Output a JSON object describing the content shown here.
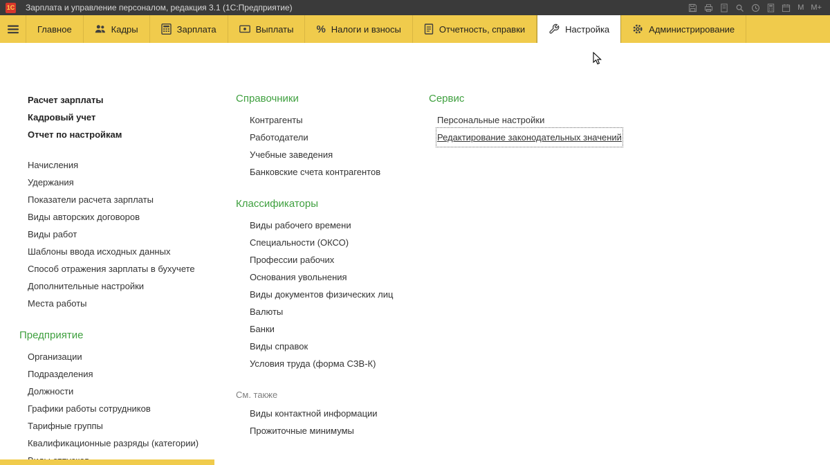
{
  "titlebar": {
    "app_badge": "1С",
    "title": "Зарплата и управление персоналом, редакция 3.1  (1С:Предприятие)",
    "m_label": "M",
    "m_plus_label": "M+"
  },
  "ribbon": {
    "tabs": [
      {
        "label": "Главное"
      },
      {
        "label": "Кадры"
      },
      {
        "label": "Зарплата"
      },
      {
        "label": "Выплаты"
      },
      {
        "label": "Налоги и взносы"
      },
      {
        "label": "Отчетность, справки"
      },
      {
        "label": "Настройка",
        "active": true
      },
      {
        "label": "Администрирование"
      }
    ]
  },
  "menu": {
    "col1": {
      "bold_links": [
        "Расчет зарплаты",
        "Кадровый учет",
        "Отчет по настройкам"
      ],
      "links": [
        "Начисления",
        "Удержания",
        "Показатели расчета зарплаты",
        "Виды авторских договоров",
        "Виды работ",
        "Шаблоны ввода исходных данных",
        "Способ отражения зарплаты в бухучете",
        "Дополнительные настройки",
        "Места работы"
      ],
      "section2_title": "Предприятие",
      "section2_links": [
        "Организации",
        "Подразделения",
        "Должности",
        "Графики работы сотрудников",
        "Тарифные группы",
        "Квалификационные разряды (категории)",
        "Виды отпусков"
      ]
    },
    "col2": {
      "section1_title": "Справочники",
      "section1_links": [
        "Контрагенты",
        "Работодатели",
        "Учебные заведения",
        "Банковские счета контрагентов"
      ],
      "section2_title": "Классификаторы",
      "section2_links": [
        "Виды рабочего времени",
        "Специальности (ОКСО)",
        "Профессии рабочих",
        "Основания увольнения",
        "Виды документов физических лиц",
        "Валюты",
        "Банки",
        "Виды справок",
        "Условия труда (форма СЗВ-К)"
      ],
      "see_also_title": "См. также",
      "see_also_links": [
        "Виды контактной информации",
        "Прожиточные минимумы"
      ]
    },
    "col3": {
      "section_title": "Сервис",
      "links": [
        "Персональные настройки",
        "Редактирование законодательных значений"
      ]
    }
  },
  "colors": {
    "ribbon_bg": "#f0cb4c",
    "titlebar_bg": "#3a3a3a",
    "green_header": "#3fa03f",
    "badge_red": "#d6372c"
  }
}
